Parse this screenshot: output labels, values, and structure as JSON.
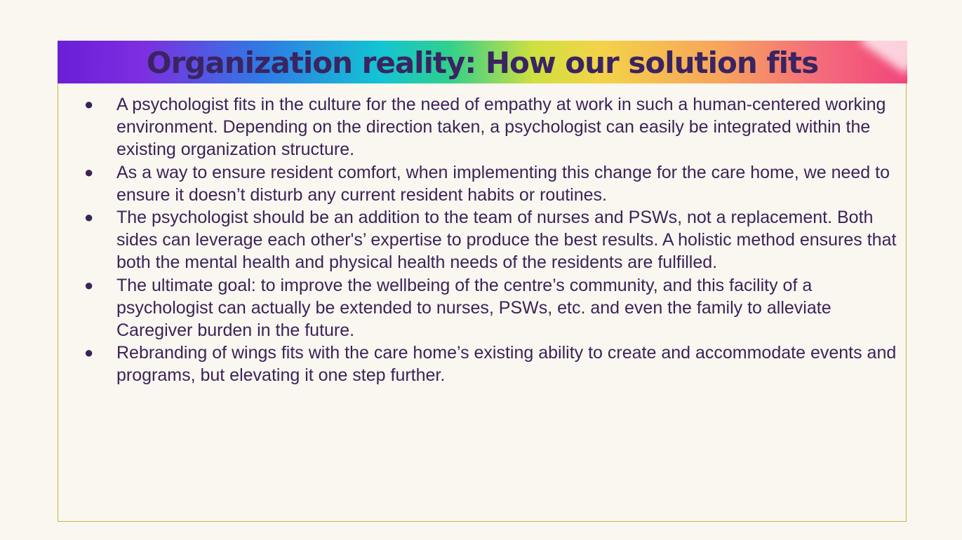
{
  "slide": {
    "title": "Organization reality: How our solution fits",
    "bullet_glyph": "●",
    "bullets": [
      "A psychologist fits in the culture for the need of empathy at work in such a human-centered working environment. Depending on the direction taken, a psychologist can easily be integrated within the existing organization structure.",
      "As a way to ensure resident comfort, when implementing this change for the care home, we need to ensure it doesn’t disturb any current resident habits or routines.",
      "The psychologist should be an addition to the team of nurses and PSWs, not a replacement. Both sides can leverage each other's’ expertise to produce the best results. A holistic method ensures that both the mental health and physical health needs of the residents are fulfilled.",
      "The ultimate goal: to improve the wellbeing of the centre’s community, and this facility of a psychologist can actually be extended to nurses, PSWs, etc. and even the family to alleviate Caregiver burden in the future.",
      "Rebranding of wings fits with the care home’s existing ability to create and accommodate events and programs, but elevating it one step further."
    ]
  },
  "colors": {
    "background": "#faf7f0",
    "frame_border": "#c9b24a",
    "title_text": "#3a2461",
    "body_text": "#3b2358",
    "gradient": [
      "#6a1fd6",
      "#2f7ae4",
      "#13c4d3",
      "#2fd08c",
      "#f4d348",
      "#f7a45c",
      "#f2457a"
    ]
  }
}
